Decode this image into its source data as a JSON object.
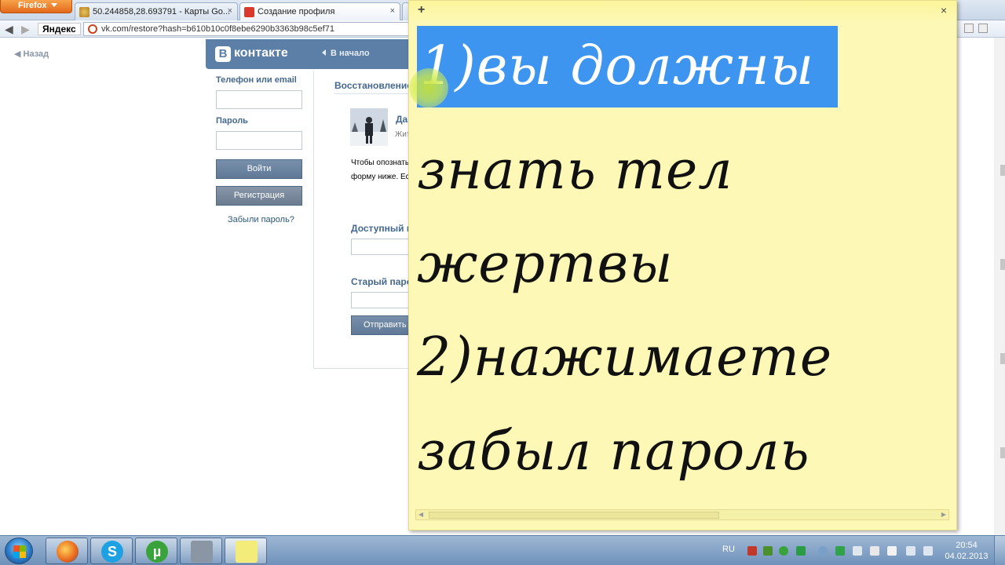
{
  "browser": {
    "firefox_label": "Firefox",
    "tabs": [
      {
        "label": "50.244858,28.693791 - Карты Go..."
      },
      {
        "label": "Создание профиля"
      }
    ],
    "yandex_label": "Яндекс",
    "url": "vk.com/restore?hash=b610b10c0f8ebe6290b3363b98c5ef71"
  },
  "vk": {
    "back_label": "Назад",
    "logo_letter": "В",
    "logo_text": "контакте",
    "home_label": "В начало",
    "login": {
      "phone_label": "Телефон или email",
      "password_label": "Пароль",
      "login_button": "Войти",
      "register_button": "Регистрация",
      "forgot_link": "Забыли пароль?"
    },
    "restore": {
      "section_title": "Восстановление доступа",
      "user_name": "Да",
      "user_sub": "Жит",
      "text_line1": "Чтобы опознать",
      "text_line2": "форму ниже. Ес",
      "available_label": "Доступный н",
      "old_password_label": "Старый паро",
      "send_button": "Отправить з"
    }
  },
  "sticky_note": {
    "add_icon": "+",
    "close_icon": "×",
    "lines": [
      "1)вы должны",
      "знать тел",
      "жертвы",
      "2)нажимаете",
      "забыл пароль"
    ]
  },
  "taskbar": {
    "skype_glyph": "S",
    "utorrent_glyph": "µ",
    "language": "RU",
    "time": "20:54",
    "date": "04.02.2013"
  }
}
